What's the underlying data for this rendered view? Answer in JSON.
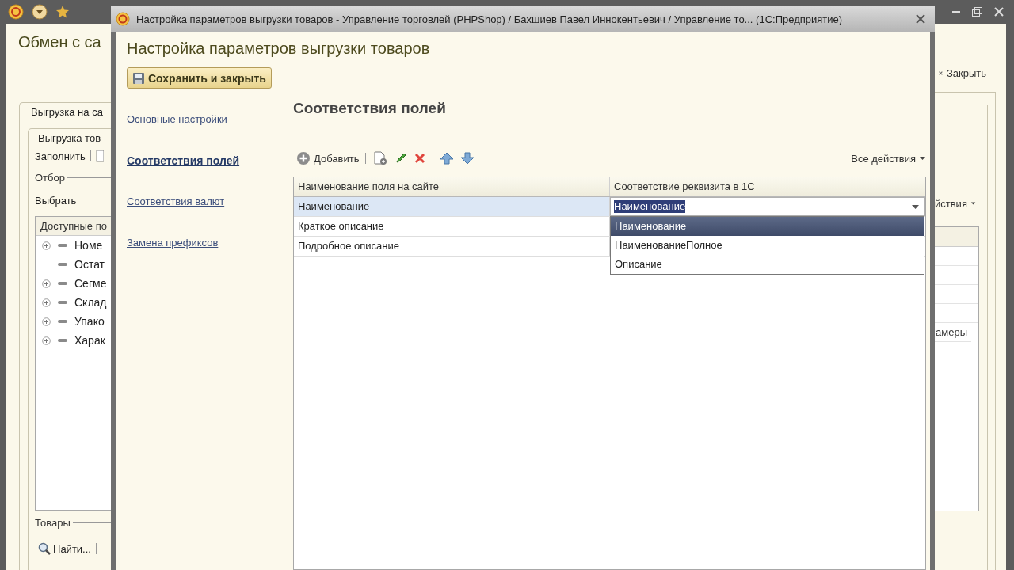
{
  "background_window": {
    "title": "Обмен с са",
    "close_button": "Закрыть",
    "outer_tab": "Выгрузка на са",
    "inner_tab": "Выгрузка тов",
    "fill_button": "Заполнить",
    "filter_group": "Отбор",
    "select_button": "Выбрать",
    "available_fields": {
      "header": "Доступные по",
      "items": [
        {
          "label": "Номе",
          "expandable": true
        },
        {
          "label": "Остат",
          "expandable": false
        },
        {
          "label": "Сегме",
          "expandable": true
        },
        {
          "label": "Склад",
          "expandable": true
        },
        {
          "label": "Упако",
          "expandable": true
        },
        {
          "label": "Харак",
          "expandable": true
        }
      ]
    },
    "goods_group": "Товары",
    "find_button": "Найти...",
    "actions_menu": "йствия",
    "table_cell": "амеры"
  },
  "dialog": {
    "title": "Настройка параметров выгрузки товаров - Управление торговлей (PHPShop) / Бахшиев Павел Иннокентьевич / Управление то... (1С:Предприятие)",
    "heading": "Настройка параметров выгрузки товаров",
    "save_button": "Сохранить и закрыть",
    "nav": [
      {
        "label": "Основные настройки",
        "selected": false
      },
      {
        "label": "Соответствия полей",
        "selected": true
      },
      {
        "label": "Соответствия валют",
        "selected": false
      },
      {
        "label": "Замена префиксов",
        "selected": false
      }
    ],
    "section_title": "Соответствия полей",
    "add_button": "Добавить",
    "all_actions": "Все действия",
    "table": {
      "columns": [
        "Наименование поля на сайте",
        "Соответствие реквизита в 1С"
      ],
      "rows": [
        {
          "site_field": "Наименование",
          "selected": true
        },
        {
          "site_field": "Краткое описание",
          "selected": false
        },
        {
          "site_field": "Подробное описание",
          "selected": false
        }
      ]
    },
    "editor": {
      "value": "Наименование",
      "options": [
        {
          "label": "Наименование",
          "selected": true
        },
        {
          "label": "НаименованиеПолное",
          "selected": false
        },
        {
          "label": "Описание",
          "selected": false
        }
      ]
    }
  }
}
